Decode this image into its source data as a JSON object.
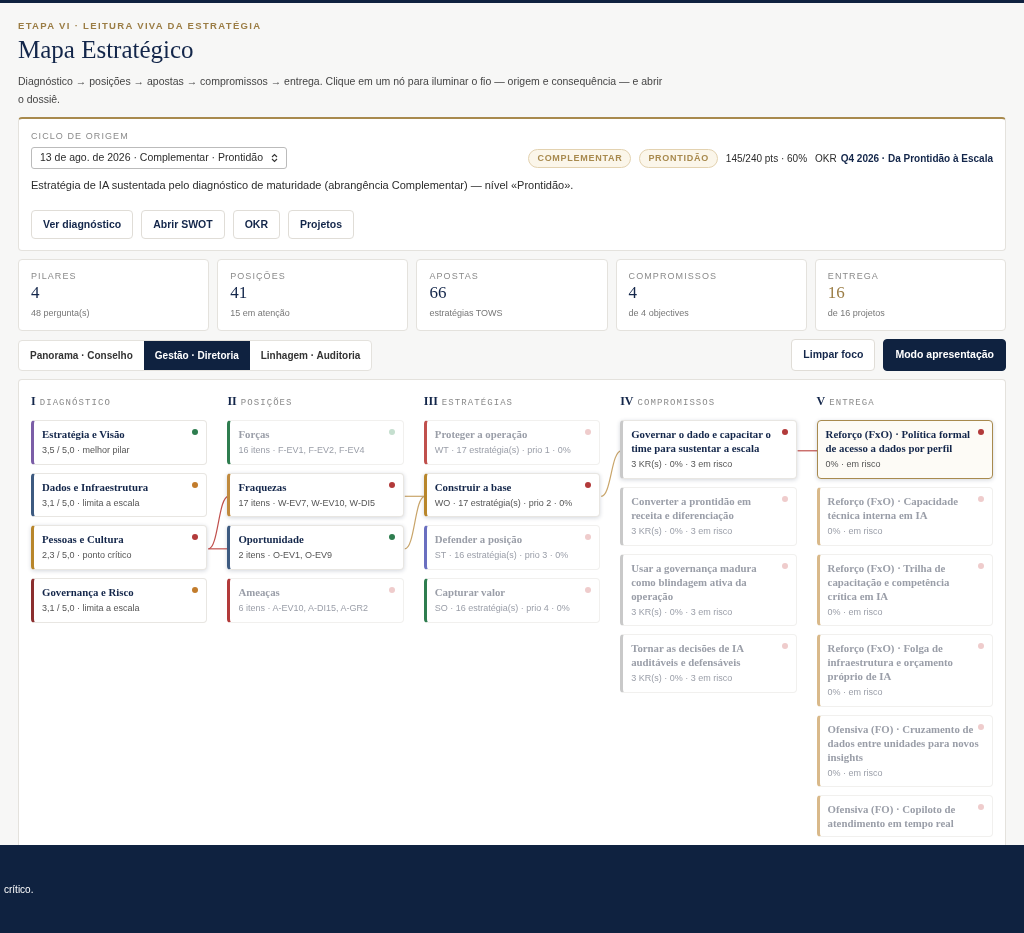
{
  "header": {
    "eyebrow": "ETAPA VI · LEITURA VIVA DA ESTRATÉGIA",
    "title": "Mapa Estratégico",
    "intro": "Diagnóstico → posições → apostas → compromissos → entrega. Clique em um nó para iluminar o fio — origem e consequência — e abrir o dossiê."
  },
  "cycle": {
    "label": "CICLO DE ORIGEM",
    "select_value": "13 de ago. de 2026 · Complementar · Prontidão",
    "badges": [
      "COMPLEMENTAR",
      "PRONTIDÃO"
    ],
    "score": "145/240 pts · 60%",
    "okr_label": "OKR",
    "okr_value": "Q4 2026 · Da Prontidão à Escala",
    "description": "Estratégia de IA sustentada pelo diagnóstico de maturidade (abrangência Complementar) — nível «Prontidão».",
    "buttons": [
      "Ver diagnóstico",
      "Abrir SWOT",
      "OKR",
      "Projetos"
    ]
  },
  "stats": [
    {
      "label": "PILARES",
      "value": "4",
      "note": "48 pergunta(s)",
      "highlight": false
    },
    {
      "label": "POSIÇÕES",
      "value": "41",
      "note": "15 em atenção",
      "highlight": false
    },
    {
      "label": "APOSTAS",
      "value": "66",
      "note": "estratégias TOWS",
      "highlight": false
    },
    {
      "label": "COMPROMISSOS",
      "value": "4",
      "note": "de 4 objectives",
      "highlight": false
    },
    {
      "label": "ENTREGA",
      "value": "16",
      "note": "de 16 projetos",
      "highlight": true
    }
  ],
  "views": [
    {
      "label": "Panorama · Conselho",
      "selected": false
    },
    {
      "label": "Gestão · Diretoria",
      "selected": true
    },
    {
      "label": "Linhagem · Auditoria",
      "selected": false
    }
  ],
  "actions": [
    {
      "label": "Limpar foco",
      "kind": "outline"
    },
    {
      "label": "Modo apresentação",
      "kind": "primary"
    }
  ],
  "columns": [
    {
      "numeral": "I",
      "title": "DIAGNÓSTICO",
      "nodes": [
        {
          "title": "Estratégia e Visão",
          "meta": "3,5 / 5,0 · melhor pilar",
          "color": "#2e7d4f",
          "dimmed": false,
          "selected": false,
          "linked": false
        },
        {
          "title": "Dados e Infraestrutura",
          "meta": "3,1 / 5,0 · limita a escala",
          "color": "#c27c2c",
          "dimmed": false,
          "selected": false,
          "linked": false
        },
        {
          "title": "Pessoas e Cultura",
          "meta": "2,3 / 5,0 · ponto crítico",
          "color": "#b23a3a",
          "dimmed": false,
          "selected": false,
          "linked": true
        },
        {
          "title": "Governança e Risco",
          "meta": "3,1 / 5,0 · limita a escala",
          "color": "#c27c2c",
          "dimmed": false,
          "selected": false,
          "linked": false
        }
      ]
    },
    {
      "numeral": "II",
      "title": "POSIÇÕES",
      "nodes": [
        {
          "title": "Forças",
          "meta": "16 itens · F-EV1, F-EV2, F-EV4",
          "color": "#c5dfcf",
          "dimmed": true,
          "selected": false,
          "linked": false
        },
        {
          "title": "Fraquezas",
          "meta": "17 itens · W-EV7, W-EV10, W-DI5",
          "color": "#b23a3a",
          "dimmed": false,
          "selected": false,
          "linked": true
        },
        {
          "title": "Oportunidade",
          "meta": "2 itens · O-EV1, O-EV9",
          "color": "#2e7d4f",
          "dimmed": false,
          "selected": false,
          "linked": true
        },
        {
          "title": "Ameaças",
          "meta": "6 itens · A-EV10, A-DI15, A-GR2",
          "color": "#efcccc",
          "dimmed": true,
          "selected": false,
          "linked": false
        }
      ]
    },
    {
      "numeral": "III",
      "title": "ESTRATÉGIAS",
      "nodes": [
        {
          "title": "Proteger a operação",
          "meta": "WT · 17 estratégia(s) · prio 1 · 0%",
          "color": "#efcccc",
          "dimmed": true,
          "selected": false,
          "linked": false
        },
        {
          "title": "Construir a base",
          "meta": "WO · 17 estratégia(s) · prio 2 · 0%",
          "color": "#b23a3a",
          "dimmed": false,
          "selected": false,
          "linked": true
        },
        {
          "title": "Defender a posição",
          "meta": "ST · 16 estratégia(s) · prio 3 · 0%",
          "color": "#efcccc",
          "dimmed": true,
          "selected": false,
          "linked": false
        },
        {
          "title": "Capturar valor",
          "meta": "SO · 16 estratégia(s) · prio 4 · 0%",
          "color": "#efcccc",
          "dimmed": true,
          "selected": false,
          "linked": false
        }
      ]
    },
    {
      "numeral": "IV",
      "title": "COMPROMISSOS",
      "nodes": [
        {
          "title": "Governar o dado e capacitar o time para sustentar a escala",
          "meta": "3 KR(s) · 0% · 3 em risco",
          "color": "#b23a3a",
          "dimmed": false,
          "selected": false,
          "linked": true
        },
        {
          "title": "Converter a prontidão em receita e diferenciação",
          "meta": "3 KR(s) · 0% · 3 em risco",
          "color": "#efcccc",
          "dimmed": true,
          "selected": false,
          "linked": false
        },
        {
          "title": "Usar a governança madura como blindagem ativa da operação",
          "meta": "3 KR(s) · 0% · 3 em risco",
          "color": "#efcccc",
          "dimmed": true,
          "selected": false,
          "linked": false
        },
        {
          "title": "Tornar as decisões de IA auditáveis e defensáveis",
          "meta": "3 KR(s) · 0% · 3 em risco",
          "color": "#efcccc",
          "dimmed": true,
          "selected": false,
          "linked": false
        }
      ]
    },
    {
      "numeral": "V",
      "title": "ENTREGA",
      "nodes": [
        {
          "title": "Reforço (FxO) · Política formal de acesso a dados por perfil",
          "meta": "0% · em risco",
          "color": "#b23a3a",
          "dimmed": false,
          "selected": true,
          "linked": true
        },
        {
          "title": "Reforço (FxO) · Capacidade técnica interna em IA",
          "meta": "0% · em risco",
          "color": "#efcccc",
          "dimmed": true,
          "selected": false,
          "linked": false
        },
        {
          "title": "Reforço (FxO) · Trilha de capacitação e competência crítica em IA",
          "meta": "0% · em risco",
          "color": "#efcccc",
          "dimmed": true,
          "selected": false,
          "linked": false
        },
        {
          "title": "Reforço (FxO) · Folga de infraestrutura e orçamento próprio de IA",
          "meta": "0% · em risco",
          "color": "#efcccc",
          "dimmed": true,
          "selected": false,
          "linked": false
        },
        {
          "title": "Ofensiva (FO) · Cruzamento de dados entre unidades para novos insights",
          "meta": "0% · em risco",
          "color": "#efcccc",
          "dimmed": true,
          "selected": false,
          "linked": false
        },
        {
          "title": "Ofensiva (FO) · Copiloto de atendimento em tempo real",
          "color": "#efcccc",
          "dimmed": true,
          "selected": false,
          "linked": false
        }
      ]
    }
  ],
  "bottom_bar": {
    "text": "crítico."
  }
}
